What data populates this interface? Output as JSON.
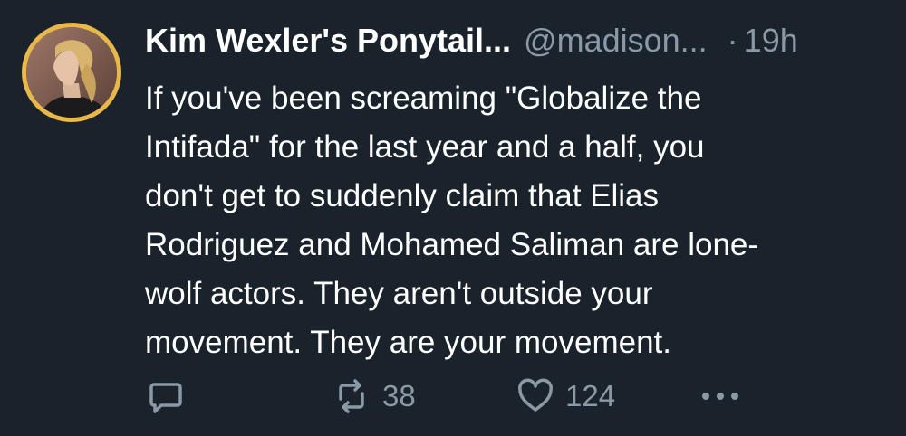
{
  "tweet": {
    "author_name": "Kim Wexler's Ponytail...",
    "author_handle": "@madison...",
    "separator": "·",
    "time": "19h",
    "text_lines": [
      "If you've been screaming \"Globalize the",
      "Intifada\" for the last year and a half, you",
      "don't get to suddenly claim that Elias",
      "Rodriguez and Mohamed Saliman are lone-",
      "wolf actors. They aren't outside your",
      "movement. They are your movement."
    ]
  },
  "actions": {
    "reply_icon": "reply-icon",
    "retweet_icon": "retweet-icon",
    "retweet_count": "38",
    "like_icon": "heart-icon",
    "like_count": "124",
    "more_icon": "more-icon"
  },
  "colors": {
    "background": "#1a222c",
    "text": "#ffffff",
    "secondary": "#8b98a5",
    "avatar_ring": "#e8b84a"
  }
}
